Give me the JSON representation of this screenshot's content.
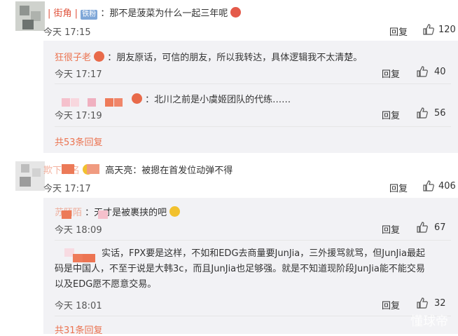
{
  "comments": [
    {
      "name": "| 街角 |",
      "badge": "铁粉",
      "text": "：那不是菠菜为什么一起三年呢",
      "time": "今天 17:15",
      "reply": "回复",
      "likes": "120"
    },
    {
      "name": "狂很子老",
      "text": "：朋友原话，可信的朋友，所以我转达，具体逻辑我不太清楚。",
      "time": "今天 17:17",
      "reply": "回复",
      "likes": "40"
    },
    {
      "text": "：北川之前是小虞姬团队的代练……",
      "time": "今天 17:19",
      "reply": "回复",
      "likes": "56"
    },
    {
      "more": "共53条回复"
    },
    {
      "name": "欺下首名",
      "text": "：高天亮：被摁在首发位动弹不得",
      "time": "今天 17:17",
      "reply": "回复",
      "likes": "406"
    },
    {
      "name": "苏陌陌",
      "text": "：天才是被裹挟的吧",
      "time": "今天 18:09",
      "reply": "回复",
      "likes": "67"
    },
    {
      "text_lines": [
        "实话，FPX要是这样，不如和EDG去商量要JunJia，三外援骂就骂，但JunJia最起",
        "码是中国人，不至于说是大韩3c，而且JunJia也足够强。就是不知道现阶段JunJia能不能交易",
        "以及EDG愿不愿意交易。"
      ],
      "time": "今天 18:01",
      "reply": "回复",
      "likes": "32"
    },
    {
      "more": "共31条回复"
    }
  ],
  "watermark": "懂球帝",
  "colors": {
    "accent": "#eb7350",
    "thread_bg": "#f2f2f5",
    "badge": "#7fa7d8"
  },
  "icons": {
    "like": "thumb-up-icon",
    "emoji": "emoji-icon"
  }
}
